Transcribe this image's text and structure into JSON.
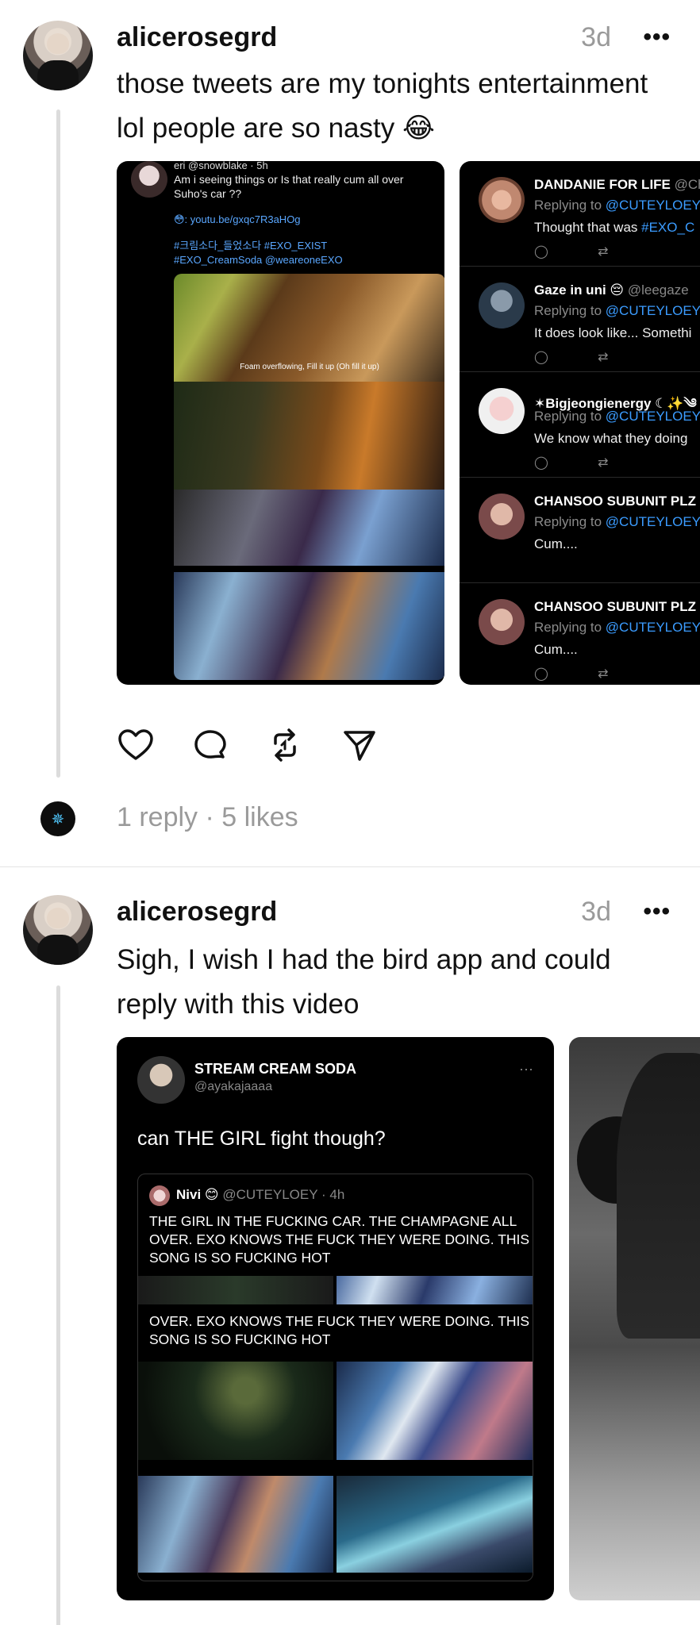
{
  "posts": [
    {
      "username": "alicerosegrd",
      "time": "3d",
      "more": "•••",
      "text": "those tweets are my tonights entertainment lol people are so nasty 😂",
      "stats": "1 reply · 5 likes",
      "embed1": {
        "header": "eri @snowblake · 5h",
        "body": "Am i seeing things or Is that really cum all over Suho's car ??",
        "link": "😳: youtu.be/gxqc7R3aHOg",
        "tags": "#크림소다_들었소다 #EXO_EXIST #EXO_CreamSoda @weareoneEXO",
        "caption": "Foam overflowing, Fill it up (Oh fill it up)"
      },
      "replies": [
        {
          "name": "DANDANIE FOR LIFE",
          "handle": "@Ch",
          "replying": "Replying to",
          "to": "@CUTEYLOEY",
          "text": "Thought that was ",
          "tag": "#EXO_C"
        },
        {
          "name": "Gaze in uni 😔",
          "handle": "@leegaze",
          "replying": "Replying to",
          "to": "@CUTEYLOEY",
          "text": "It does look like... Somethi",
          "tag": ""
        },
        {
          "name": "✶Bigjeongienergy ☾✨༄",
          "handle": "",
          "replying": "Replying to",
          "to": "@CUTEYLOEY",
          "text": "We know what they doing",
          "tag": ""
        },
        {
          "name": "CHANSOO SUBUNIT PLZ",
          "handle": "",
          "replying": "Replying to",
          "to": "@CUTEYLOEY",
          "text": "Cum....",
          "tag": ""
        },
        {
          "name": "CHANSOO SUBUNIT PLZ",
          "handle": "",
          "replying": "Replying to",
          "to": "@CUTEYLOEY",
          "text": "Cum....",
          "tag": ""
        }
      ]
    },
    {
      "username": "alicerosegrd",
      "time": "3d",
      "more": "•••",
      "text": "Sigh, I wish I had the bird app and could reply with this video",
      "video": {
        "name": "STREAM CREAM SODA",
        "handle": "@ayakajaaaa",
        "dots": "···",
        "question": "can THE GIRL fight though?",
        "quote_name": "Nivi 😊",
        "quote_handle": "@CUTEYLOEY · 4h",
        "quote_text": "THE GIRL IN THE FUCKING CAR. THE CHAMPAGNE ALL OVER. EXO KNOWS THE FUCK THEY WERE DOING. THIS SONG IS SO FUCKING HOT",
        "quote_text_2": "OVER. EXO KNOWS THE FUCK THEY WERE DOING. THIS SONG IS SO FUCKING HOT"
      }
    }
  ],
  "icons": {
    "like": "heart-icon",
    "comment": "comment-icon",
    "repost": "repost-icon",
    "share": "send-icon"
  }
}
